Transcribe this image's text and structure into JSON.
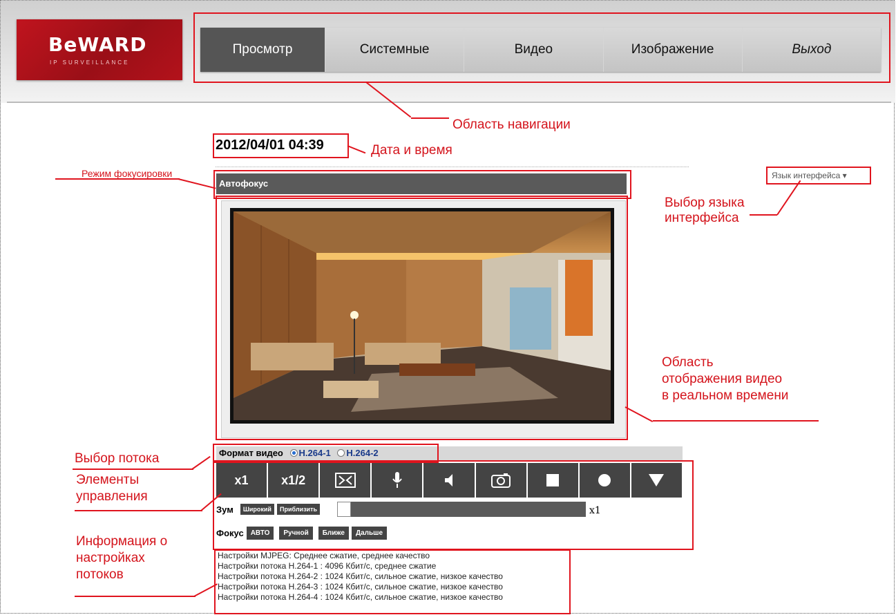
{
  "brand": {
    "name": "BeWARD",
    "tagline": "IP SURVEILLANCE"
  },
  "nav": {
    "items": [
      {
        "label": "Просмотр",
        "active": true
      },
      {
        "label": "Системные"
      },
      {
        "label": "Видео"
      },
      {
        "label": "Изображение"
      },
      {
        "label": "Выход"
      }
    ]
  },
  "datetime": "2012/04/01 04:39",
  "focus_mode": "Автофокус",
  "language_selector": "Язык интерфейса ▾",
  "stream": {
    "label": "Формат видео",
    "options": [
      "H.264-1",
      "H.264-2"
    ],
    "selected": "H.264-1"
  },
  "controls": {
    "buttons": [
      "x1",
      "x1/2",
      "fit-icon",
      "mic-icon",
      "speaker-icon",
      "camera-icon",
      "stop-icon",
      "record-icon",
      "dropdown-icon"
    ]
  },
  "zoom": {
    "label": "Зум",
    "wide": "Широкий",
    "tele": "Приблизить",
    "value": "x1"
  },
  "focus": {
    "label": "Фокус",
    "auto": "АВТО",
    "manual": "Ручной",
    "near": "Ближе",
    "far": "Дальше"
  },
  "stream_info": [
    "Настройки MJPEG: Среднее сжатие, среднее качество",
    "Настройки потока H.264-1 : 4096 Кбит/с, среднее сжатие",
    "Настройки потока H.264-2 : 1024 Кбит/с, сильное сжатие, низкое качество",
    "Настройки потока H.264-3 : 1024 Кбит/с, сильное сжатие, низкое качество",
    "Настройки потока H.264-4 : 1024 Кбит/с, сильное сжатие, низкое качество"
  ],
  "annotations": {
    "nav": "Область навигации",
    "datetime": "Дата и время",
    "focus": "Режим фокусировки",
    "lang_1": "Выбор языка",
    "lang_2": "интерфейса",
    "video_1": "Область",
    "video_2": "отображения видео",
    "video_3": "в реальном времени",
    "stream": "Выбор потока",
    "controls_1": "Элементы",
    "controls_2": "управления",
    "info_1": "Информация о",
    "info_2": "настройках",
    "info_3": "потоков"
  },
  "colors": {
    "accent": "#e0141e",
    "logo": "#c0141e",
    "nav_active": "#555555"
  }
}
